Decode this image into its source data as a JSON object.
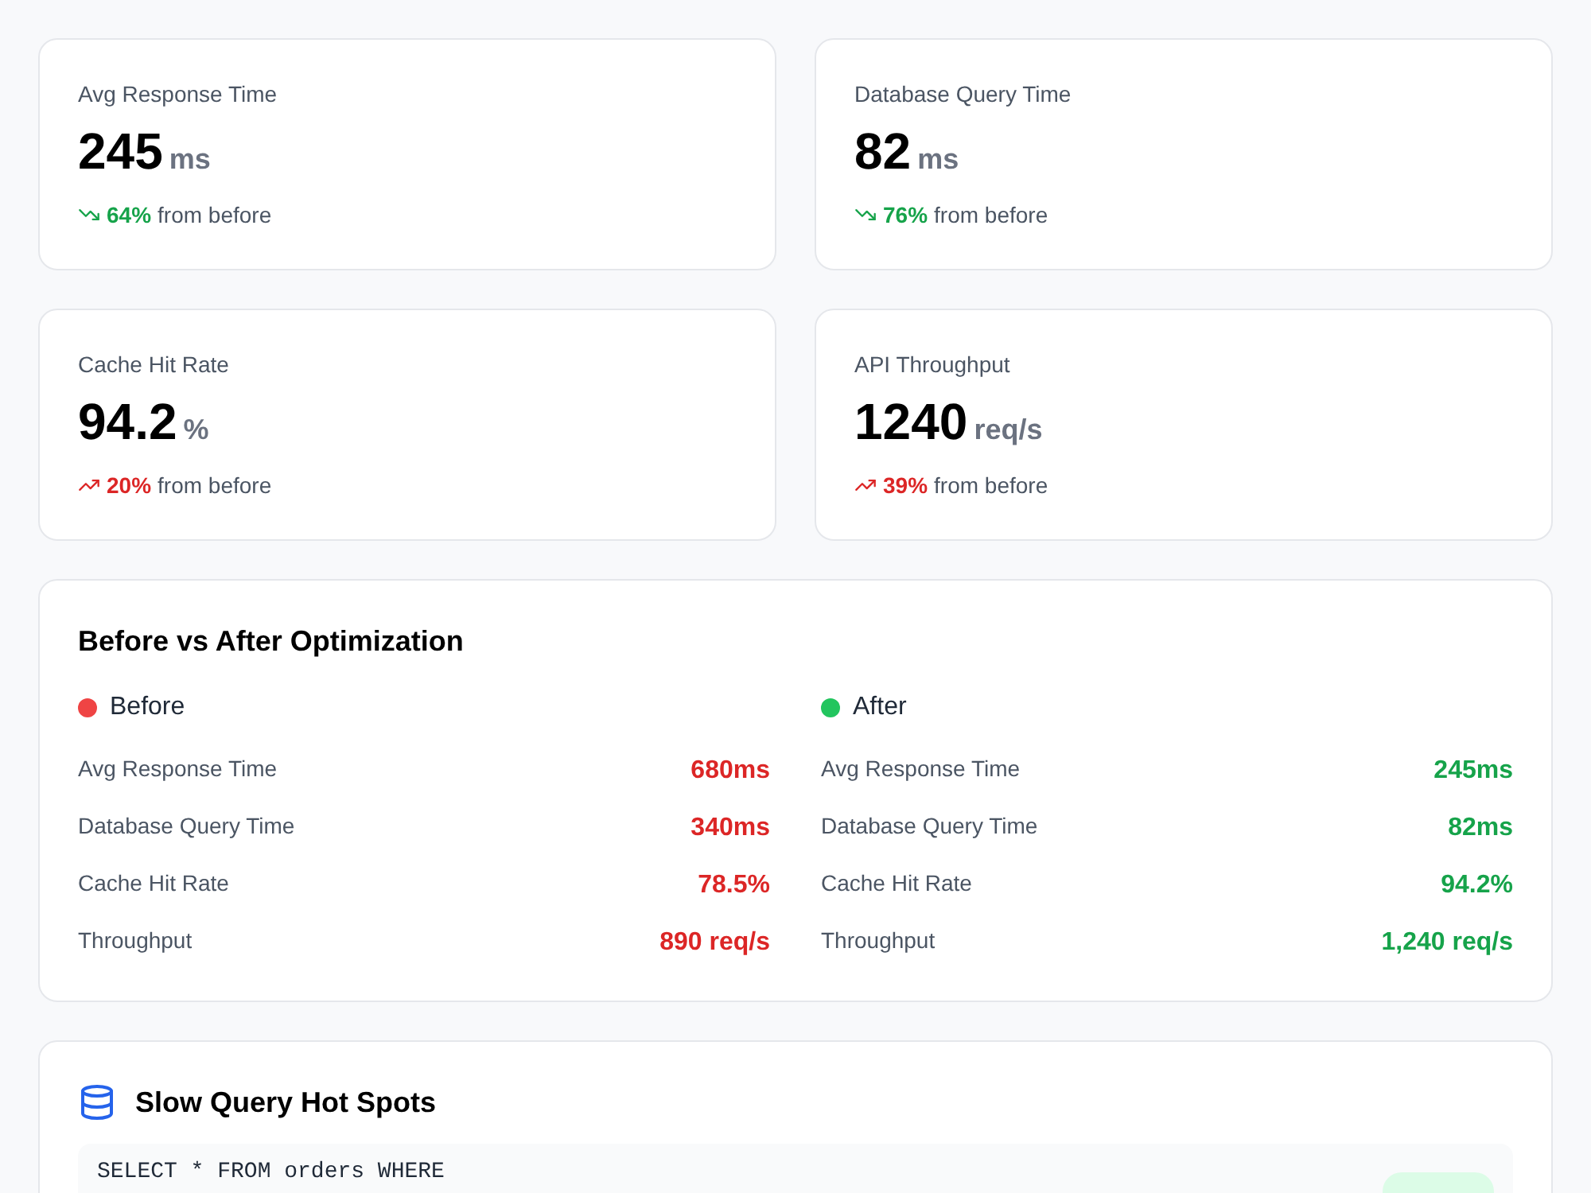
{
  "metrics": [
    {
      "label": "Avg Response Time",
      "value": "245",
      "unit": "ms",
      "trend_up": false,
      "change": "64%",
      "note": "from before"
    },
    {
      "label": "Database Query Time",
      "value": "82",
      "unit": "ms",
      "trend_up": false,
      "change": "76%",
      "note": "from before"
    },
    {
      "label": "Cache Hit Rate",
      "value": "94.2",
      "unit": "%",
      "trend_up": true,
      "change": "20%",
      "note": "from before"
    },
    {
      "label": "API Throughput",
      "value": "1240",
      "unit": "req/s",
      "trend_up": true,
      "change": "39%",
      "note": "from before"
    }
  ],
  "comparison": {
    "title": "Before vs After Optimization",
    "columns": [
      {
        "kind": "before",
        "label": "Before",
        "color": "#ef4444",
        "rows": [
          {
            "label": "Avg Response Time",
            "value": "680ms"
          },
          {
            "label": "Database Query Time",
            "value": "340ms"
          },
          {
            "label": "Cache Hit Rate",
            "value": "78.5%"
          },
          {
            "label": "Throughput",
            "value": "890 req/s"
          }
        ]
      },
      {
        "kind": "after",
        "label": "After",
        "color": "#22c55e",
        "rows": [
          {
            "label": "Avg Response Time",
            "value": "245ms"
          },
          {
            "label": "Database Query Time",
            "value": "82ms"
          },
          {
            "label": "Cache Hit Rate",
            "value": "94.2%"
          },
          {
            "label": "Throughput",
            "value": "1,240 req/s"
          }
        ]
      }
    ]
  },
  "hot_spots": {
    "title": "Slow Query Hot Spots",
    "queries": [
      {
        "sql": "SELECT * FROM orders WHERE"
      }
    ]
  }
}
